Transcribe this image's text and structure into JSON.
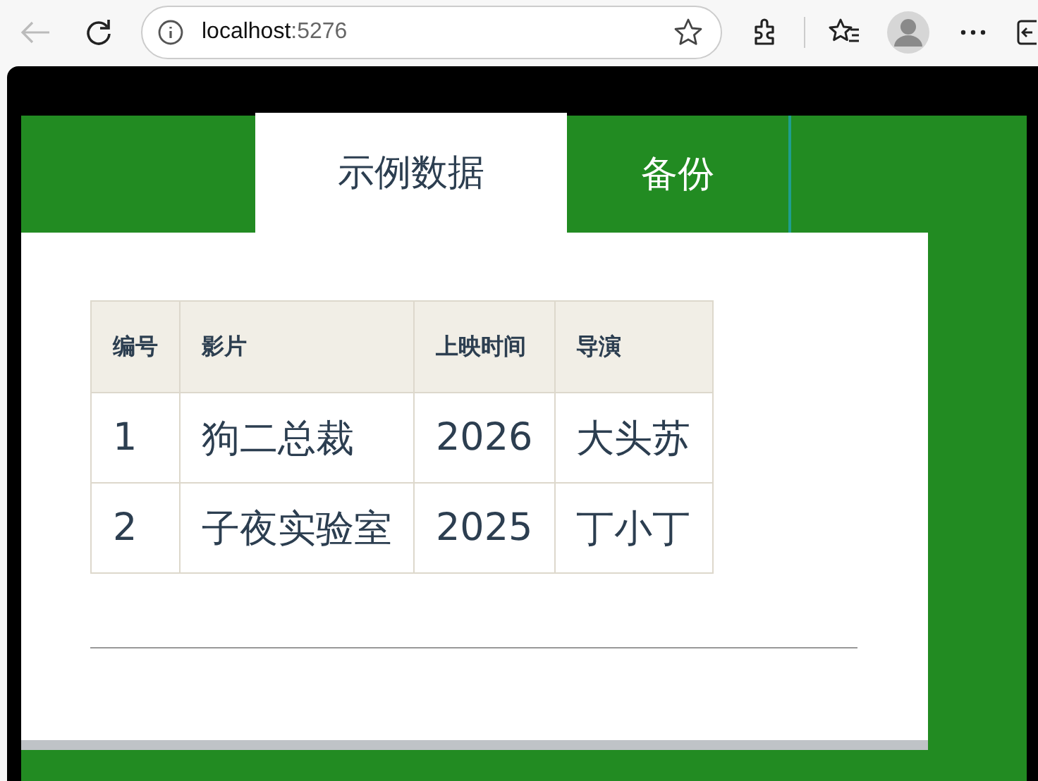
{
  "browser": {
    "address_host": "localhost",
    "address_port": ":5276"
  },
  "tabs": [
    {
      "label": "示例数据",
      "selected": true
    },
    {
      "label": "备份",
      "selected": false
    }
  ],
  "table": {
    "columns": [
      "编号",
      "影片",
      "上映时间",
      "导演"
    ],
    "rows": [
      [
        "1",
        "狗二总裁",
        "2026",
        "大头苏"
      ],
      [
        "2",
        "子夜实验室",
        "2025",
        "丁小丁"
      ]
    ]
  }
}
